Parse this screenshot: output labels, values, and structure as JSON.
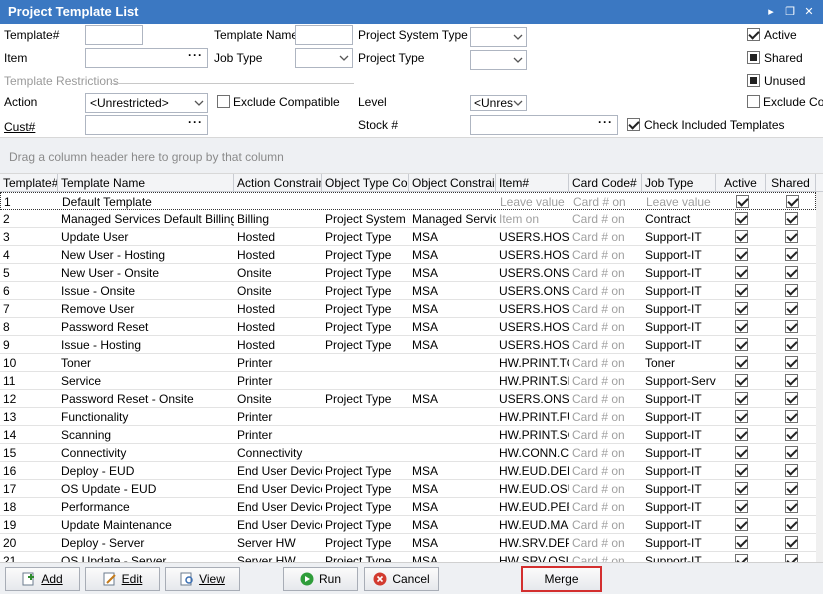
{
  "window": {
    "title": "Project Template List"
  },
  "filters": {
    "template_no_label": "Template#",
    "template_name_label": "Template Name",
    "project_system_type_label": "Project System Type",
    "item_label": "Item",
    "job_type_label": "Job Type",
    "project_type_label": "Project Type",
    "template_restrictions_label": "Template Restrictions",
    "action_label": "Action",
    "action_value": "<Unrestricted>",
    "exclude_compatible_label": "Exclude Compatible",
    "level_label": "Level",
    "level_value": "<Unres",
    "cust_label": "Cust#",
    "stock_label": "Stock #",
    "check_included_label": "Check Included Templates",
    "active_label": "Active",
    "shared_label": "Shared",
    "unused_label": "Unused",
    "exclude_com_label": "Exclude Com"
  },
  "group_hint": "Drag a column header here to group by that column",
  "columns": [
    "Template#",
    "Template Name",
    "Action Constraint",
    "Object Type Cons",
    "Object Constraint",
    "Item#",
    "Card Code#",
    "Job Type",
    "Active",
    "Shared"
  ],
  "rows": [
    {
      "no": "1",
      "name": "Default Template",
      "action": "",
      "otype": "",
      "oconst": "",
      "item": "Leave value",
      "card": "Card # on",
      "job": "Leave value",
      "active": true,
      "shared": true
    },
    {
      "no": "2",
      "name": "Managed Services Default Billing",
      "action": "Billing",
      "otype": "Project System",
      "oconst": "Managed Service",
      "item": "Item on",
      "card": "Card # on",
      "job": "Contract",
      "active": true,
      "shared": true
    },
    {
      "no": "3",
      "name": "Update User",
      "action": "Hosted",
      "otype": "Project Type",
      "oconst": "MSA",
      "item": "USERS.HOSTE",
      "card": "Card # on",
      "job": "Support-IT",
      "active": true,
      "shared": true
    },
    {
      "no": "4",
      "name": "New User - Hosting",
      "action": "Hosted",
      "otype": "Project Type",
      "oconst": "MSA",
      "item": "USERS.HOSTE",
      "card": "Card # on",
      "job": "Support-IT",
      "active": true,
      "shared": true
    },
    {
      "no": "5",
      "name": "New User - Onsite",
      "action": "Onsite",
      "otype": "Project Type",
      "oconst": "MSA",
      "item": "USERS.ONSIT",
      "card": "Card # on",
      "job": "Support-IT",
      "active": true,
      "shared": true
    },
    {
      "no": "6",
      "name": "Issue - Onsite",
      "action": "Onsite",
      "otype": "Project Type",
      "oconst": "MSA",
      "item": "USERS.ONSIT",
      "card": "Card # on",
      "job": "Support-IT",
      "active": true,
      "shared": true
    },
    {
      "no": "7",
      "name": "Remove User",
      "action": "Hosted",
      "otype": "Project Type",
      "oconst": "MSA",
      "item": "USERS.HOSTE",
      "card": "Card # on",
      "job": "Support-IT",
      "active": true,
      "shared": true
    },
    {
      "no": "8",
      "name": "Password Reset",
      "action": "Hosted",
      "otype": "Project Type",
      "oconst": "MSA",
      "item": "USERS.HOSTE",
      "card": "Card # on",
      "job": "Support-IT",
      "active": true,
      "shared": true
    },
    {
      "no": "9",
      "name": "Issue - Hosting",
      "action": "Hosted",
      "otype": "Project Type",
      "oconst": "MSA",
      "item": "USERS.HOSTE",
      "card": "Card # on",
      "job": "Support-IT",
      "active": true,
      "shared": true
    },
    {
      "no": "10",
      "name": "Toner",
      "action": "Printer",
      "otype": "",
      "oconst": "",
      "item": "HW.PRINT.TO",
      "card": "Card # on",
      "job": "Toner",
      "active": true,
      "shared": true
    },
    {
      "no": "11",
      "name": "Service",
      "action": "Printer",
      "otype": "",
      "oconst": "",
      "item": "HW.PRINT.SE",
      "card": "Card # on",
      "job": "Support-Servi",
      "active": true,
      "shared": true
    },
    {
      "no": "12",
      "name": "Password Reset - Onsite",
      "action": "Onsite",
      "otype": "Project Type",
      "oconst": "MSA",
      "item": "USERS.ONSIT",
      "card": "Card # on",
      "job": "Support-IT",
      "active": true,
      "shared": true
    },
    {
      "no": "13",
      "name": "Functionality",
      "action": "Printer",
      "otype": "",
      "oconst": "",
      "item": "HW.PRINT.FU",
      "card": "Card # on",
      "job": "Support-IT",
      "active": true,
      "shared": true
    },
    {
      "no": "14",
      "name": "Scanning",
      "action": "Printer",
      "otype": "",
      "oconst": "",
      "item": "HW.PRINT.SC",
      "card": "Card # on",
      "job": "Support-IT",
      "active": true,
      "shared": true
    },
    {
      "no": "15",
      "name": "Connectivity",
      "action": "Connectivity",
      "otype": "",
      "oconst": "",
      "item": "HW.CONN.CO",
      "card": "Card # on",
      "job": "Support-IT",
      "active": true,
      "shared": true
    },
    {
      "no": "16",
      "name": "Deploy - EUD",
      "action": "End User Device",
      "otype": "Project Type",
      "oconst": "MSA",
      "item": "HW.EUD.DEPL",
      "card": "Card # on",
      "job": "Support-IT",
      "active": true,
      "shared": true
    },
    {
      "no": "17",
      "name": "OS Update - EUD",
      "action": "End User Device",
      "otype": "Project Type",
      "oconst": "MSA",
      "item": "HW.EUD.OSU",
      "card": "Card # on",
      "job": "Support-IT",
      "active": true,
      "shared": true
    },
    {
      "no": "18",
      "name": "Performance",
      "action": "End User Device",
      "otype": "Project Type",
      "oconst": "MSA",
      "item": "HW.EUD.PER",
      "card": "Card # on",
      "job": "Support-IT",
      "active": true,
      "shared": true
    },
    {
      "no": "19",
      "name": "Update Maintenance",
      "action": "End User Device",
      "otype": "Project Type",
      "oconst": "MSA",
      "item": "HW.EUD.MAI",
      "card": "Card # on",
      "job": "Support-IT",
      "active": true,
      "shared": true
    },
    {
      "no": "20",
      "name": "Deploy - Server",
      "action": "Server HW",
      "otype": "Project Type",
      "oconst": "MSA",
      "item": "HW.SRV.DEPL",
      "card": "Card # on",
      "job": "Support-IT",
      "active": true,
      "shared": true
    },
    {
      "no": "21",
      "name": "OS Update - Server",
      "action": "Server HW",
      "otype": "Project Type",
      "oconst": "MSA",
      "item": "HW.SRV.OSU",
      "card": "Card # on",
      "job": "Support-IT",
      "active": true,
      "shared": true
    }
  ],
  "buttons": {
    "add": "Add",
    "edit": "Edit",
    "view": "View",
    "run": "Run",
    "cancel": "Cancel",
    "merge": "Merge"
  }
}
